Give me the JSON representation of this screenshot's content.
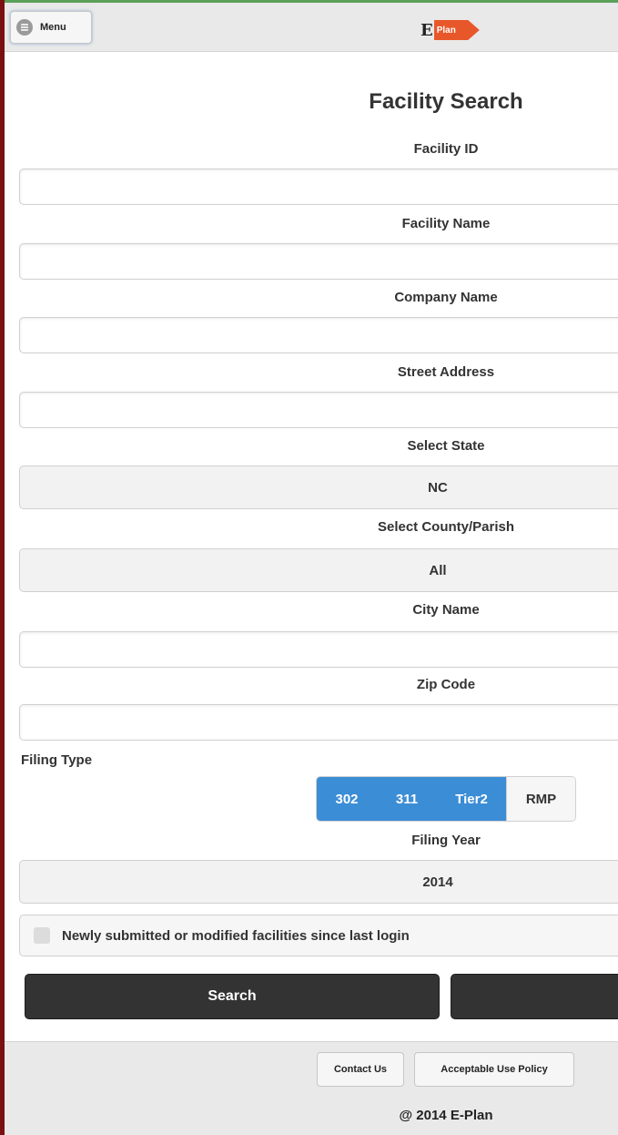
{
  "header": {
    "menu_label": "Menu",
    "logo_letter": "E",
    "logo_text": "Plan"
  },
  "form": {
    "title": "Facility Search",
    "facility_id": {
      "label": "Facility ID",
      "value": ""
    },
    "facility_name": {
      "label": "Facility Name",
      "value": ""
    },
    "company_name": {
      "label": "Company Name",
      "value": ""
    },
    "street_address": {
      "label": "Street Address",
      "value": ""
    },
    "state": {
      "label": "Select State",
      "value": "NC"
    },
    "county": {
      "label": "Select County/Parish",
      "value": "All"
    },
    "city_name": {
      "label": "City Name",
      "value": ""
    },
    "zip_code": {
      "label": "Zip Code",
      "value": ""
    },
    "filing_type": {
      "label": "Filing Type",
      "options": [
        {
          "label": "302",
          "selected": true
        },
        {
          "label": "311",
          "selected": true
        },
        {
          "label": "Tier2",
          "selected": true
        },
        {
          "label": "RMP",
          "selected": false
        }
      ]
    },
    "filing_year": {
      "label": "Filing Year",
      "value": "2014"
    },
    "newly_submitted": {
      "label": "Newly submitted or modified facilities since last login",
      "checked": false
    },
    "search_label": "Search"
  },
  "footer": {
    "contact_label": "Contact Us",
    "policy_label": "Acceptable Use Policy",
    "copyright": "@ 2014 E-Plan"
  },
  "colors": {
    "accent": "#3b8dd6",
    "button_dark": "#333333",
    "logo_orange": "#e8572a"
  }
}
